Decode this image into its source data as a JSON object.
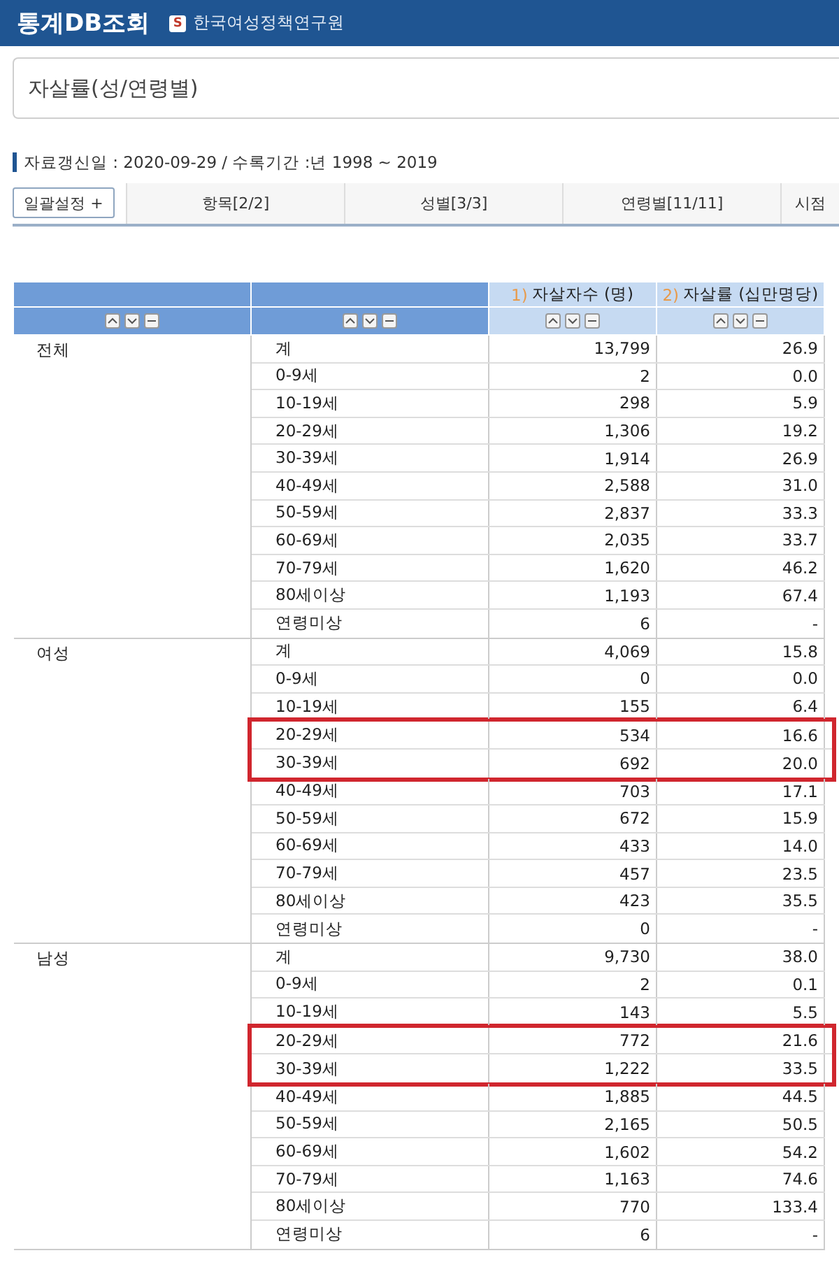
{
  "header": {
    "title": "통계DB조회",
    "org_badge": "S",
    "org": "한국여성정책연구원"
  },
  "page_title": "자살률(성/연령별)",
  "info": "자료갱신일 : 2020-09-29 / 수록기간 :년 1998 ~ 2019",
  "filter_bar": {
    "button": "일괄설정 +",
    "tabs": [
      "항목[2/2]",
      "성별[3/3]",
      "연령별[11/11]",
      "시점"
    ]
  },
  "table": {
    "columns": [
      {
        "kind": "dim"
      },
      {
        "kind": "dim"
      },
      {
        "kind": "value",
        "number": "1)",
        "label": "자살자수 (명)"
      },
      {
        "kind": "value",
        "number": "2)",
        "label": "자살률 (십만명당)"
      }
    ],
    "groups": [
      {
        "name": "전체",
        "rows": [
          {
            "age": "계",
            "count": "13,799",
            "rate": "26.9",
            "highlighted": false
          },
          {
            "age": "0-9세",
            "count": "2",
            "rate": "0.0",
            "highlighted": false
          },
          {
            "age": "10-19세",
            "count": "298",
            "rate": "5.9",
            "highlighted": false
          },
          {
            "age": "20-29세",
            "count": "1,306",
            "rate": "19.2",
            "highlighted": false
          },
          {
            "age": "30-39세",
            "count": "1,914",
            "rate": "26.9",
            "highlighted": false
          },
          {
            "age": "40-49세",
            "count": "2,588",
            "rate": "31.0",
            "highlighted": false
          },
          {
            "age": "50-59세",
            "count": "2,837",
            "rate": "33.3",
            "highlighted": false
          },
          {
            "age": "60-69세",
            "count": "2,035",
            "rate": "33.7",
            "highlighted": false
          },
          {
            "age": "70-79세",
            "count": "1,620",
            "rate": "46.2",
            "highlighted": false
          },
          {
            "age": "80세이상",
            "count": "1,193",
            "rate": "67.4",
            "highlighted": false
          },
          {
            "age": "연령미상",
            "count": "6",
            "rate": "-",
            "highlighted": false
          }
        ]
      },
      {
        "name": "여성",
        "rows": [
          {
            "age": "계",
            "count": "4,069",
            "rate": "15.8",
            "highlighted": false
          },
          {
            "age": "0-9세",
            "count": "0",
            "rate": "0.0",
            "highlighted": false
          },
          {
            "age": "10-19세",
            "count": "155",
            "rate": "6.4",
            "highlighted": false
          },
          {
            "age": "20-29세",
            "count": "534",
            "rate": "16.6",
            "highlighted": true
          },
          {
            "age": "30-39세",
            "count": "692",
            "rate": "20.0",
            "highlighted": true
          },
          {
            "age": "40-49세",
            "count": "703",
            "rate": "17.1",
            "highlighted": false
          },
          {
            "age": "50-59세",
            "count": "672",
            "rate": "15.9",
            "highlighted": false
          },
          {
            "age": "60-69세",
            "count": "433",
            "rate": "14.0",
            "highlighted": false
          },
          {
            "age": "70-79세",
            "count": "457",
            "rate": "23.5",
            "highlighted": false
          },
          {
            "age": "80세이상",
            "count": "423",
            "rate": "35.5",
            "highlighted": false
          },
          {
            "age": "연령미상",
            "count": "0",
            "rate": "-",
            "highlighted": false
          }
        ]
      },
      {
        "name": "남성",
        "rows": [
          {
            "age": "계",
            "count": "9,730",
            "rate": "38.0",
            "highlighted": false
          },
          {
            "age": "0-9세",
            "count": "2",
            "rate": "0.1",
            "highlighted": false
          },
          {
            "age": "10-19세",
            "count": "143",
            "rate": "5.5",
            "highlighted": false
          },
          {
            "age": "20-29세",
            "count": "772",
            "rate": "21.6",
            "highlighted": true
          },
          {
            "age": "30-39세",
            "count": "1,222",
            "rate": "33.5",
            "highlighted": true
          },
          {
            "age": "40-49세",
            "count": "1,885",
            "rate": "44.5",
            "highlighted": false
          },
          {
            "age": "50-59세",
            "count": "2,165",
            "rate": "50.5",
            "highlighted": false
          },
          {
            "age": "60-69세",
            "count": "1,602",
            "rate": "54.2",
            "highlighted": false
          },
          {
            "age": "70-79세",
            "count": "1,163",
            "rate": "74.6",
            "highlighted": false
          },
          {
            "age": "80세이상",
            "count": "770",
            "rate": "133.4",
            "highlighted": false
          },
          {
            "age": "연령미상",
            "count": "6",
            "rate": "-",
            "highlighted": false
          }
        ]
      }
    ]
  }
}
